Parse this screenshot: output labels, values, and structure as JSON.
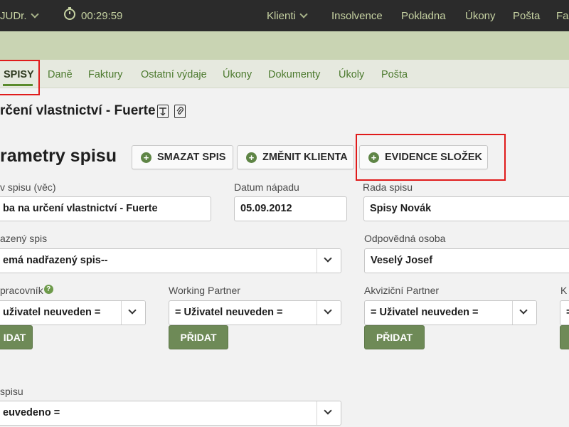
{
  "topbar": {
    "user": "JUDr.",
    "timer": "00:29:59",
    "nav": [
      "Klienti",
      "Insolvence",
      "Pokladna",
      "Úkony",
      "Pošta",
      "Fa"
    ]
  },
  "tabs": [
    "SPISY",
    "Daně",
    "Faktury",
    "Ostatní výdaje",
    "Úkony",
    "Dokumenty",
    "Úkoly",
    "Pošta"
  ],
  "case_title": "rčení vlastnictví - Fuerte",
  "section": {
    "title": "rametry spisu",
    "buttons": [
      "SMAZAT SPIS",
      "ZMĚNIT KLIENTA",
      "EVIDENCE SLOŽEK"
    ]
  },
  "fields": {
    "nazev_label": "v spisu (věc)",
    "nazev_value": "ba na určení vlastnictví - Fuerte",
    "datum_label": "Datum nápadu",
    "datum_value": "05.09.2012",
    "rada_label": "Rada spisu",
    "rada_value": "Spisy Novák",
    "nadrazeny_label": "azený spis",
    "nadrazeny_value": "emá nadřazený spis--",
    "odpovedna_label": "Odpovědná osoba",
    "odpovedna_value": "Veselý Josef",
    "spolupracovnik_label": "pracovník",
    "spolupracovnik_value": "uživatel neuveden =",
    "working_label": "Working Partner",
    "working_value": "= Uživatel neuveden =",
    "akvizicni_label": "Akviziční Partner",
    "akvizicni_value": "= Uživatel neuveden =",
    "k_label": "K",
    "k_value": "=",
    "pridat": "PŘIDAT",
    "pridat_partial": "IDAT",
    "stav_label": "spisu",
    "stav_value": "euvedeno ="
  },
  "colors": {
    "topbar": "#2b2b2b",
    "accent_green": "#5f8546",
    "highlight_red": "#e01b1b"
  }
}
